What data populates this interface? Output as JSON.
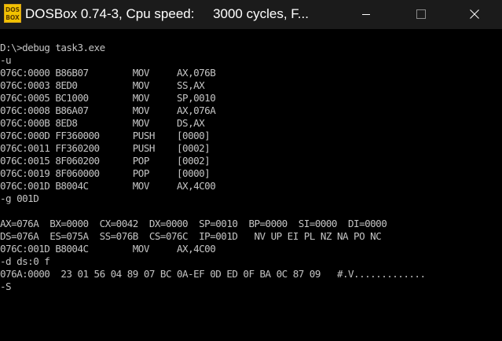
{
  "window": {
    "title": "DOSBox 0.74-3, Cpu speed:     3000 cycles, F...",
    "icon": "dosbox-logo-icon",
    "icon_text": "DOS BOX",
    "controls": {
      "minimize": "minimize-icon",
      "maximize": "maximize-icon",
      "close": "close-icon"
    }
  },
  "console": {
    "text_color": "#c4c4c4",
    "background": "#000000",
    "lines": [
      "D:\\>debug task3.exe",
      "-u",
      "076C:0000 B86B07        MOV     AX,076B",
      "076C:0003 8ED0          MOV     SS,AX",
      "076C:0005 BC1000        MOV     SP,0010",
      "076C:0008 B86A07        MOV     AX,076A",
      "076C:000B 8ED8          MOV     DS,AX",
      "076C:000D FF360000      PUSH    [0000]",
      "076C:0011 FF360200      PUSH    [0002]",
      "076C:0015 8F060200      POP     [0002]",
      "076C:0019 8F060000      POP     [0000]",
      "076C:001D B8004C        MOV     AX,4C00",
      "-g 001D",
      "",
      "AX=076A  BX=0000  CX=0042  DX=0000  SP=0010  BP=0000  SI=0000  DI=0000",
      "DS=076A  ES=075A  SS=076B  CS=076C  IP=001D   NV UP EI PL NZ NA PO NC",
      "076C:001D B8004C        MOV     AX,4C00",
      "-d ds:0 f",
      "076A:0000  23 01 56 04 89 07 BC 0A-EF 0D ED 0F BA 0C 87 09   #.V.............",
      "-S"
    ]
  }
}
